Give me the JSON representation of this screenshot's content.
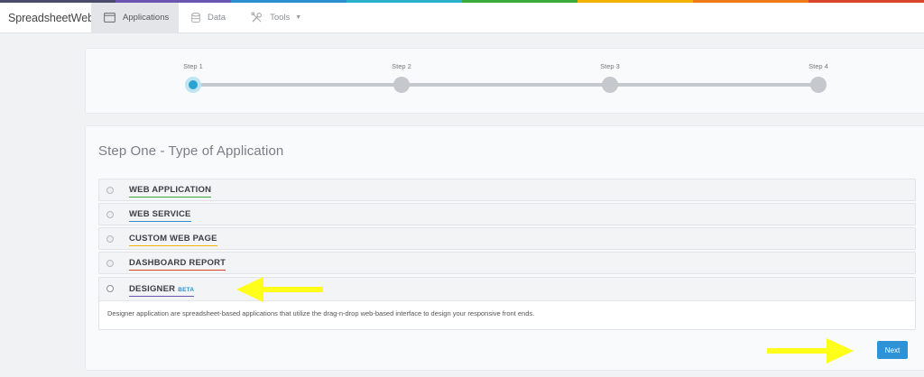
{
  "colors": {
    "strip": [
      "#4a4a6a",
      "#6a55b0",
      "#2a8fd0",
      "#2ab0c8",
      "#3aaa3a",
      "#f0b400",
      "#ef7a1a",
      "#d9452a"
    ],
    "accent": "#2e92d6",
    "annotation_arrow": "#ffff1a"
  },
  "nav": {
    "brand": "SpreadsheetWeb",
    "items": [
      {
        "label": "Applications",
        "icon": "window-icon",
        "active": true
      },
      {
        "label": "Data",
        "icon": "database-icon",
        "active": false
      },
      {
        "label": "Tools",
        "icon": "tools-icon",
        "active": false,
        "dropdown": true
      }
    ]
  },
  "steps": [
    {
      "label": "Step 1",
      "current": true
    },
    {
      "label": "Step 2",
      "current": false
    },
    {
      "label": "Step 3",
      "current": false
    },
    {
      "label": "Step 4",
      "current": false
    }
  ],
  "main": {
    "title": "Step One - Type of Application",
    "options": [
      {
        "label": "WEB APPLICATION",
        "underline": "#3aaa3a",
        "checked": false
      },
      {
        "label": "WEB SERVICE",
        "underline": "#2a8fd0",
        "checked": false
      },
      {
        "label": "CUSTOM WEB PAGE",
        "underline": "#f0b400",
        "checked": false
      },
      {
        "label": "DASHBOARD REPORT",
        "underline": "#d9452a",
        "checked": false
      }
    ],
    "selected": {
      "label": "DESIGNER",
      "badge": "BETA",
      "underline": "#6a55b0",
      "checked": true,
      "description": "Designer application are spreadsheet-based applications that utilize the drag-n-drop web-based interface to design your responsive front ends."
    },
    "next_label": "Next"
  }
}
